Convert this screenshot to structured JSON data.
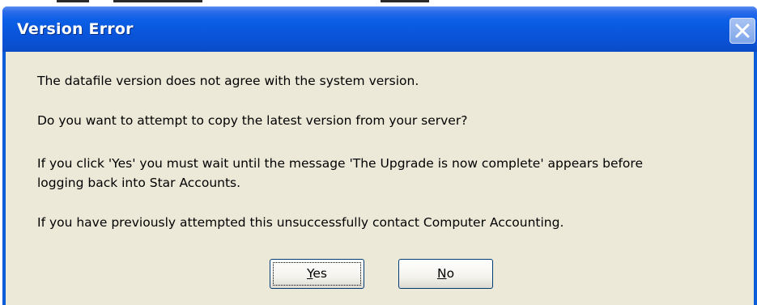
{
  "window": {
    "title": "Version Error"
  },
  "title_bar": {
    "close_icon": "close-x-icon"
  },
  "message": {
    "line1": "The datafile version does not agree with the system version.",
    "line2": "Do you want to attempt to copy the latest version from your server?",
    "line3a": "If you click 'Yes' you must wait until the message 'The Upgrade is now complete' appears before",
    "line3b": "logging back into Star Accounts.",
    "line4": "If you have previously attempted this unsuccessfully contact Computer Accounting."
  },
  "buttons": {
    "yes": {
      "mnemonic": "Y",
      "rest": "es",
      "focused": true
    },
    "no": {
      "mnemonic": "N",
      "rest": "o"
    }
  },
  "colors": {
    "titlebar": "#0a5cd8",
    "client": "#ece9d8",
    "button_border": "#003c74"
  }
}
